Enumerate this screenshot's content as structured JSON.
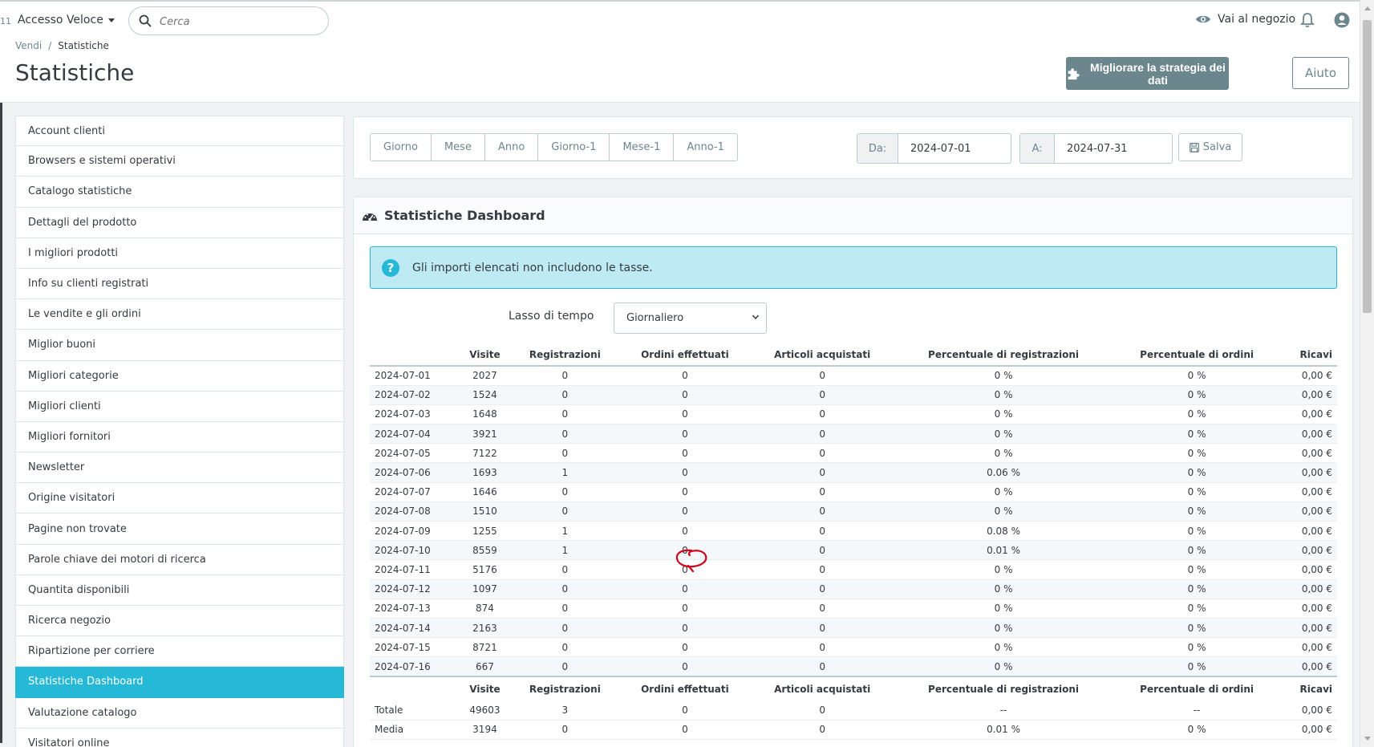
{
  "header": {
    "edge_text": "11",
    "quick_access": "Accesso Veloce",
    "search_placeholder": "Cerca",
    "shop_link": "Vai al negozio"
  },
  "titlebar": {
    "breadcrumb": [
      "Vendi",
      "Statistiche"
    ],
    "title": "Statistiche",
    "improve_button": "Migliorare la strategia dei dati",
    "help_button": "Aiuto"
  },
  "sidebar": {
    "items": [
      "Account clienti",
      "Browsers e sistemi operativi",
      "Catalogo statistiche",
      "Dettagli del prodotto",
      "I migliori prodotti",
      "Info su clienti registrati",
      "Le vendite e gli ordini",
      "Miglior buoni",
      "Migliori categorie",
      "Migliori clienti",
      "Migliori fornitori",
      "Newsletter",
      "Origine visitatori",
      "Pagine non trovate",
      "Parole chiave dei motori di ricerca",
      "Quantita disponibili",
      "Ricerca negozio",
      "Ripartizione per corriere",
      "Statistiche Dashboard",
      "Valutazione catalogo",
      "Visitatori online"
    ],
    "active": "Statistiche Dashboard"
  },
  "filters": {
    "period_buttons": [
      "Giorno",
      "Mese",
      "Anno",
      "Giorno-1",
      "Mese-1",
      "Anno-1"
    ],
    "from_label": "Da:",
    "from_value": "2024-07-01",
    "to_label": "A:",
    "to_value": "2024-07-31",
    "save_button": "Salva"
  },
  "dashboard": {
    "title": "Statistiche Dashboard",
    "info": "Gli importi elencati non includono le tasse.",
    "lasso_label": "Lasso di tempo",
    "lasso_value": "Giornaliero",
    "columns": [
      "",
      "Visite",
      "Registrazioni",
      "Ordini effettuati",
      "Articoli acquistati",
      "Percentuale di registrazioni",
      "Percentuale di ordini",
      "Ricavi"
    ],
    "rows": [
      [
        "2024-07-01",
        "2027",
        "0",
        "0",
        "0",
        "0 %",
        "0 %",
        "0,00 €"
      ],
      [
        "2024-07-02",
        "1524",
        "0",
        "0",
        "0",
        "0 %",
        "0 %",
        "0,00 €"
      ],
      [
        "2024-07-03",
        "1648",
        "0",
        "0",
        "0",
        "0 %",
        "0 %",
        "0,00 €"
      ],
      [
        "2024-07-04",
        "3921",
        "0",
        "0",
        "0",
        "0 %",
        "0 %",
        "0,00 €"
      ],
      [
        "2024-07-05",
        "7122",
        "0",
        "0",
        "0",
        "0 %",
        "0 %",
        "0,00 €"
      ],
      [
        "2024-07-06",
        "1693",
        "1",
        "0",
        "0",
        "0.06 %",
        "0 %",
        "0,00 €"
      ],
      [
        "2024-07-07",
        "1646",
        "0",
        "0",
        "0",
        "0 %",
        "0 %",
        "0,00 €"
      ],
      [
        "2024-07-08",
        "1510",
        "0",
        "0",
        "0",
        "0 %",
        "0 %",
        "0,00 €"
      ],
      [
        "2024-07-09",
        "1255",
        "1",
        "0",
        "0",
        "0.08 %",
        "0 %",
        "0,00 €"
      ],
      [
        "2024-07-10",
        "8559",
        "1",
        "0",
        "0",
        "0.01 %",
        "0 %",
        "0,00 €"
      ],
      [
        "2024-07-11",
        "5176",
        "0",
        "0",
        "0",
        "0 %",
        "0 %",
        "0,00 €"
      ],
      [
        "2024-07-12",
        "1097",
        "0",
        "0",
        "0",
        "0 %",
        "0 %",
        "0,00 €"
      ],
      [
        "2024-07-13",
        "874",
        "0",
        "0",
        "0",
        "0 %",
        "0 %",
        "0,00 €"
      ],
      [
        "2024-07-14",
        "2163",
        "0",
        "0",
        "0",
        "0 %",
        "0 %",
        "0,00 €"
      ],
      [
        "2024-07-15",
        "8721",
        "0",
        "0",
        "0",
        "0 %",
        "0 %",
        "0,00 €"
      ],
      [
        "2024-07-16",
        "667",
        "0",
        "0",
        "0",
        "0 %",
        "0 %",
        "0,00 €"
      ]
    ],
    "footer_rows": [
      [
        "Totale",
        "49603",
        "3",
        "0",
        "0",
        "--",
        "--",
        "0,00 €"
      ],
      [
        "Media",
        "3194",
        "0",
        "0",
        "0",
        "0.01 %",
        "0 %",
        "0,00 €"
      ]
    ]
  },
  "colors": {
    "accent": "#25b9d7",
    "button_dark": "#6c868e",
    "annotation": "#d0021b"
  }
}
